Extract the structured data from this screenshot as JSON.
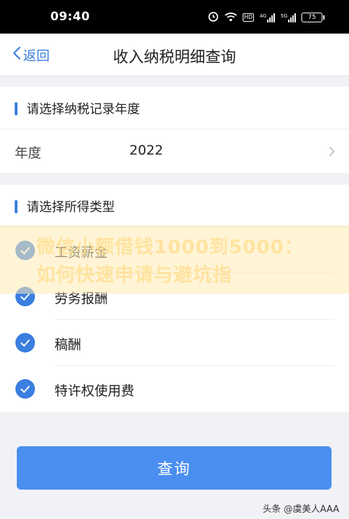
{
  "status_bar": {
    "time": "09:40",
    "battery": "75",
    "icons": [
      "alarm-icon",
      "wifi-icon",
      "hd-icon",
      "signal-4g-icon",
      "signal-5g-icon",
      "battery-icon"
    ],
    "hd_label": "HD",
    "net1": "4G",
    "net2": "5G"
  },
  "nav": {
    "back_label": "返回",
    "title": "收入纳税明细查询"
  },
  "year_section": {
    "header": "请选择纳税记录年度",
    "row_label": "年度",
    "row_value": "2022"
  },
  "income_section": {
    "header": "请选择所得类型",
    "items": [
      {
        "label": "工资薪金",
        "checked": true
      },
      {
        "label": "劳务报酬",
        "checked": true
      },
      {
        "label": "稿酬",
        "checked": true
      },
      {
        "label": "特许权使用费",
        "checked": true
      }
    ]
  },
  "watermark": {
    "text": "微信小额借钱1000到5000：如何快速申请与避坑指"
  },
  "query_button": "查询",
  "source_tag": "头条 @虞美人AAA",
  "colors": {
    "accent": "#3a7ee0",
    "button": "#4a8ef0",
    "background": "#f0f2f5"
  }
}
